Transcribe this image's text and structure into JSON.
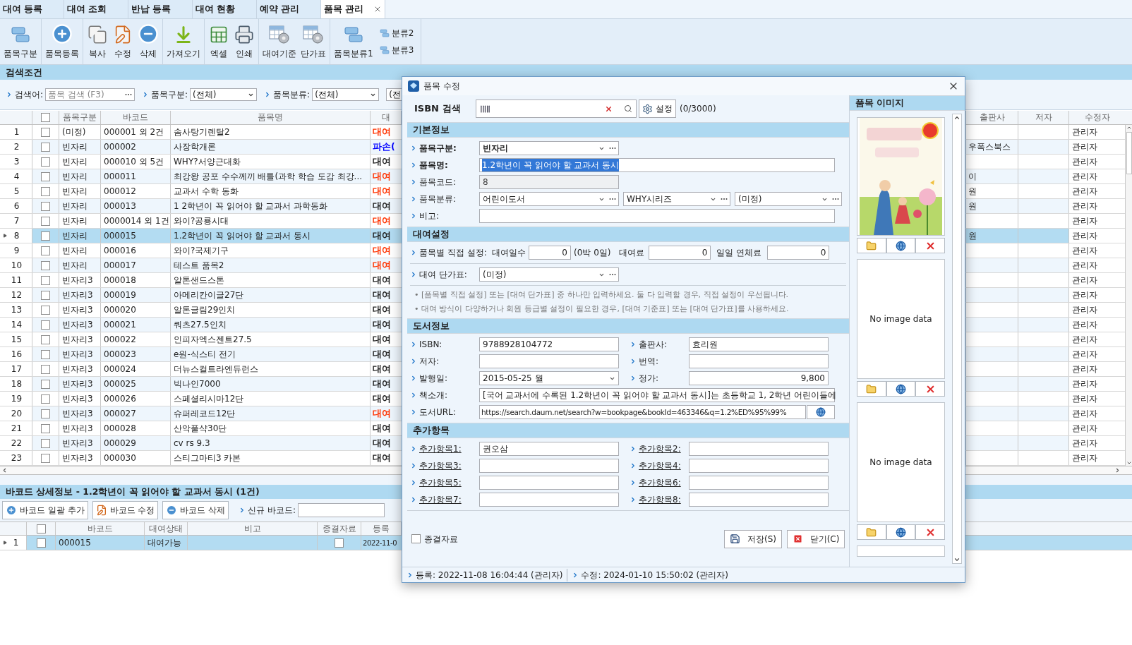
{
  "tabs": [
    {
      "label": "대여 등록",
      "selected": false
    },
    {
      "label": "대여 조회",
      "selected": false
    },
    {
      "label": "반납 등록",
      "selected": false
    },
    {
      "label": "대여 현황",
      "selected": false
    },
    {
      "label": "예약 관리",
      "selected": false
    },
    {
      "label": "품목 관리",
      "selected": true
    }
  ],
  "toolbar": {
    "groups": [
      {
        "items": [
          {
            "label": "품목구분",
            "kind": "category"
          }
        ]
      },
      {
        "items": [
          {
            "label": "품목등록",
            "kind": "add"
          }
        ]
      },
      {
        "items": [
          {
            "label": "복사",
            "kind": "copy"
          },
          {
            "label": "수정",
            "kind": "edit"
          },
          {
            "label": "삭제",
            "kind": "delete"
          }
        ]
      },
      {
        "items": [
          {
            "label": "가져오기",
            "kind": "import"
          }
        ]
      },
      {
        "items": [
          {
            "label": "엑셀",
            "kind": "excel"
          },
          {
            "label": "인쇄",
            "kind": "print"
          }
        ]
      },
      {
        "items": [
          {
            "label": "대여기준",
            "kind": "settings"
          },
          {
            "label": "단가표",
            "kind": "settings"
          }
        ]
      },
      {
        "items": [
          {
            "label": "품목분류1",
            "kind": "category"
          }
        ]
      }
    ],
    "small_items": [
      {
        "label": "분류2"
      },
      {
        "label": "분류3"
      }
    ]
  },
  "search_panel": {
    "title": "검색조건",
    "fields": [
      {
        "label": "검색어:",
        "placeholder": "품목 검색 (F3)",
        "kind": "ellipsis"
      },
      {
        "label": "품목구분:",
        "value": "(전체)",
        "kind": "dropdown"
      },
      {
        "label": "품목분류:",
        "value": "(전체)",
        "kind": "dropdown"
      },
      {
        "value": "(전",
        "kind": "cut"
      }
    ]
  },
  "table": {
    "header_checked": false,
    "columns": [
      "품목구분",
      "바코드",
      "품목명",
      "대",
      "출판사",
      "저자",
      "수정자"
    ],
    "rows": [
      {
        "no": "1",
        "checked": false,
        "category": "(미정)",
        "barcode": "000001 외 2건",
        "name": "솜사탕기렌탈2",
        "status": {
          "text": "대여",
          "color": "#ff3300"
        },
        "editor": "관리자",
        "selected": false
      },
      {
        "no": "2",
        "checked": false,
        "category": "빈자리",
        "barcode": "000002",
        "name": "사장학개론",
        "status": {
          "text": "파손(",
          "color": "#0000ff"
        },
        "publisher": "우폭스북스",
        "editor": "관리자",
        "selected": false
      },
      {
        "no": "3",
        "checked": false,
        "category": "빈자리",
        "barcode": "000010 외 5건",
        "name": "WHY?서양근대화",
        "status": {
          "text": "대여",
          "color": "#222222"
        },
        "editor": "관리자",
        "selected": false
      },
      {
        "no": "4",
        "checked": false,
        "category": "빈자리",
        "barcode": "000011",
        "name": "최강왕 공포 수수께끼 배틀(과학 학습 도감 최강...",
        "status": {
          "text": "대여",
          "color": "#ff3300"
        },
        "publisher": "이",
        "editor": "관리자",
        "selected": false
      },
      {
        "no": "5",
        "checked": false,
        "category": "빈자리",
        "barcode": "000012",
        "name": "교과서 수학 동화",
        "status": {
          "text": "대여",
          "color": "#ff3300"
        },
        "publisher": "원",
        "editor": "관리자",
        "selected": false
      },
      {
        "no": "6",
        "checked": false,
        "category": "빈자리",
        "barcode": "000013",
        "name": "1 2학년이 꼭 읽어야 할 교과서 과학동화",
        "status": {
          "text": "대여",
          "color": "#222222"
        },
        "publisher": "원",
        "editor": "관리자",
        "selected": false
      },
      {
        "no": "7",
        "checked": false,
        "category": "빈자리",
        "barcode": "0000014 외 1건",
        "name": "와이?공룡시대",
        "status": {
          "text": "대여",
          "color": "#ff3300"
        },
        "editor": "관리자",
        "selected": false
      },
      {
        "no": "8",
        "checked": false,
        "category": "빈자리",
        "barcode": "000015",
        "name": "1.2학년이 꼭 읽어야 할 교과서 동시",
        "status": {
          "text": "대여",
          "color": "#222222"
        },
        "publisher": "원",
        "editor": "관리자",
        "selected": true
      },
      {
        "no": "9",
        "checked": false,
        "category": "빈자리",
        "barcode": "000016",
        "name": "와이?국제기구",
        "status": {
          "text": "대여",
          "color": "#ff3300"
        },
        "editor": "관리자",
        "selected": false
      },
      {
        "no": "10",
        "checked": false,
        "category": "빈자리",
        "barcode": "000017",
        "name": "테스트 품목2",
        "status": {
          "text": "대여",
          "color": "#ff3300"
        },
        "editor": "관리자",
        "selected": false
      },
      {
        "no": "11",
        "checked": false,
        "category": "빈자리3",
        "barcode": "000018",
        "name": "알톤샌드스톤",
        "status": {
          "text": "대여",
          "color": "#222222"
        },
        "editor": "관리자",
        "selected": false
      },
      {
        "no": "12",
        "checked": false,
        "category": "빈자리3",
        "barcode": "000019",
        "name": "아메리칸이글27단",
        "status": {
          "text": "대여",
          "color": "#222222"
        },
        "editor": "관리자",
        "selected": false
      },
      {
        "no": "13",
        "checked": false,
        "category": "빈자리3",
        "barcode": "000020",
        "name": "알톤글림29인치",
        "status": {
          "text": "대여",
          "color": "#222222"
        },
        "editor": "관리자",
        "selected": false
      },
      {
        "no": "14",
        "checked": false,
        "category": "빈자리3",
        "barcode": "000021",
        "name": "쿼츠27.5인치",
        "status": {
          "text": "대여",
          "color": "#222222"
        },
        "editor": "관리자",
        "selected": false
      },
      {
        "no": "15",
        "checked": false,
        "category": "빈자리3",
        "barcode": "000022",
        "name": "인피자엑스젠트27.5",
        "status": {
          "text": "대여",
          "color": "#222222"
        },
        "editor": "관리자",
        "selected": false
      },
      {
        "no": "16",
        "checked": false,
        "category": "빈자리3",
        "barcode": "000023",
        "name": "e원-식스티 전기",
        "status": {
          "text": "대여",
          "color": "#222222"
        },
        "editor": "관리자",
        "selected": false
      },
      {
        "no": "17",
        "checked": false,
        "category": "빈자리3",
        "barcode": "000024",
        "name": "더뉴스컬트라엔듀런스",
        "status": {
          "text": "대여",
          "color": "#222222"
        },
        "editor": "관리자",
        "selected": false
      },
      {
        "no": "18",
        "checked": false,
        "category": "빈자리3",
        "barcode": "000025",
        "name": "빅나인7000",
        "status": {
          "text": "대여",
          "color": "#222222"
        },
        "editor": "관리자",
        "selected": false
      },
      {
        "no": "19",
        "checked": false,
        "category": "빈자리3",
        "barcode": "000026",
        "name": "스페셜리시마12단",
        "status": {
          "text": "대여",
          "color": "#222222"
        },
        "editor": "관리자",
        "selected": false
      },
      {
        "no": "20",
        "checked": false,
        "category": "빈자리3",
        "barcode": "000027",
        "name": "슈퍼레코드12단",
        "status": {
          "text": "대여",
          "color": "#ff3300"
        },
        "editor": "관리자",
        "selected": false
      },
      {
        "no": "21",
        "checked": false,
        "category": "빈자리3",
        "barcode": "000028",
        "name": "산악풀샥30단",
        "status": {
          "text": "대여",
          "color": "#222222"
        },
        "editor": "관리자",
        "selected": false
      },
      {
        "no": "22",
        "checked": false,
        "category": "빈자리3",
        "barcode": "000029",
        "name": "cv rs 9.3",
        "status": {
          "text": "대여",
          "color": "#222222"
        },
        "editor": "관리자",
        "selected": false
      },
      {
        "no": "23",
        "checked": false,
        "category": "빈자리3",
        "barcode": "000030",
        "name": "스티그마티3 카본",
        "status": {
          "text": "대여",
          "color": "#222222"
        },
        "editor": "관리자",
        "selected": false
      }
    ]
  },
  "barcode_panel": {
    "title": "바코드 상세정보 - 1.2학년이 꼭 읽어야 할 교과서 동시 (1건)",
    "buttons": [
      {
        "label": "바코드 일괄 추가",
        "kind": "add"
      },
      {
        "label": "바코드 수정",
        "kind": "edit"
      },
      {
        "label": "바코드 삭제",
        "kind": "delete"
      }
    ],
    "new_barcode": {
      "label": "신규 바코드:"
    },
    "header_checked": false,
    "columns": [
      "바코드",
      "대여상태",
      "비고",
      "종결자료",
      "등록"
    ],
    "rows": [
      {
        "no": "1",
        "checked": false,
        "barcode": "000015",
        "status": "대여가능",
        "closed": false,
        "date": "2022-11-0",
        "selected": true
      }
    ]
  },
  "dialog": {
    "title": "품목 수정",
    "isbn_search": {
      "label": "ISBN 검색",
      "button": "설정",
      "count": "(0/3000)"
    },
    "basic": {
      "title": "기본정보",
      "category": {
        "label": "품목구분:",
        "value": "빈자리",
        "required": true
      },
      "name": {
        "label": "품목명:",
        "value": "1.2학년이 꼭 읽어야 할 교과서 동시",
        "required": true,
        "text_selected": true
      },
      "code": {
        "label": "품목코드:",
        "value": "8",
        "required": false,
        "disabled": true
      },
      "classification": {
        "label": "품목분류:",
        "values": [
          "어린이도서",
          "WHY시리즈",
          "(미정)"
        ],
        "required": false
      },
      "note": {
        "label": "비고:",
        "required": false
      }
    },
    "rental": {
      "title": "대여설정",
      "direct_label": "품목별 직접 설정:",
      "days_label": "대여일수",
      "days": "0",
      "days_text": "(0박 0일)",
      "fee_label": "대여료",
      "fee": "0",
      "late_label": "일일 연체료",
      "late": "0",
      "price_table": {
        "label": "대여 단가표:",
        "value": "(미정)"
      },
      "notes": [
        "• [품목별 직접 설정] 또는 [대여 단가표] 중 하나만 입력하세요. 둘 다 입력할 경우, 직접 설정이 우선됩니다.",
        "• 대여 방식이 다양하거나 회원 등급별 설정이 필요한 경우, [대여 기준표] 또는 [대여 단가표]를 사용하세요."
      ]
    },
    "book": {
      "title": "도서정보",
      "fields": [
        {
          "label": "ISBN:",
          "value": "9788928104772",
          "kind": "text"
        },
        {
          "label": "출판사:",
          "value": "효리원",
          "kind": "text"
        },
        {
          "label": "저자:",
          "kind": "text"
        },
        {
          "label": "번역:",
          "kind": "text"
        },
        {
          "label": "발행일:",
          "value": "2015-05-25 월",
          "kind": "date"
        },
        {
          "label": "정가:",
          "value": "9,800",
          "kind": "number"
        }
      ],
      "intro": {
        "label": "책소개:",
        "value": "[국어 교과서에 수록된 1.2학년이 꼭 읽어야 할 교과서 동시]는 초등학교 1, 2학년 어린이들에"
      },
      "url": {
        "label": "도서URL:",
        "value": "https://search.daum.net/search?w=bookpage&bookId=463346&q=1.2%ED%95%99%"
      }
    },
    "extra": {
      "title": "추가항목",
      "fields": [
        {
          "label": "추가항목1:",
          "value": "권오삼"
        },
        {
          "label": "추가항목2:"
        },
        {
          "label": "추가항목3:"
        },
        {
          "label": "추가항목4:"
        },
        {
          "label": "추가항목5:"
        },
        {
          "label": "추가항목6:"
        },
        {
          "label": "추가항목7:"
        },
        {
          "label": "추가항목8:"
        }
      ]
    },
    "closed_item": {
      "label": "종결자료",
      "checked": false
    },
    "buttons": [
      {
        "label": "저장(S)",
        "kind": "save"
      },
      {
        "label": "닫기(C)",
        "kind": "close"
      }
    ],
    "status_bar": [
      "등록: 2022-11-08 16:04:44 (관리자)",
      "수정: 2024-01-10 15:50:02 (관리자)"
    ],
    "images": {
      "title": "품목 이미지",
      "slots": [
        {
          "kind": "picture"
        },
        {
          "kind": "empty",
          "text": "No image data"
        },
        {
          "kind": "empty",
          "text": "No image data"
        },
        {
          "kind": "partial"
        }
      ]
    }
  }
}
